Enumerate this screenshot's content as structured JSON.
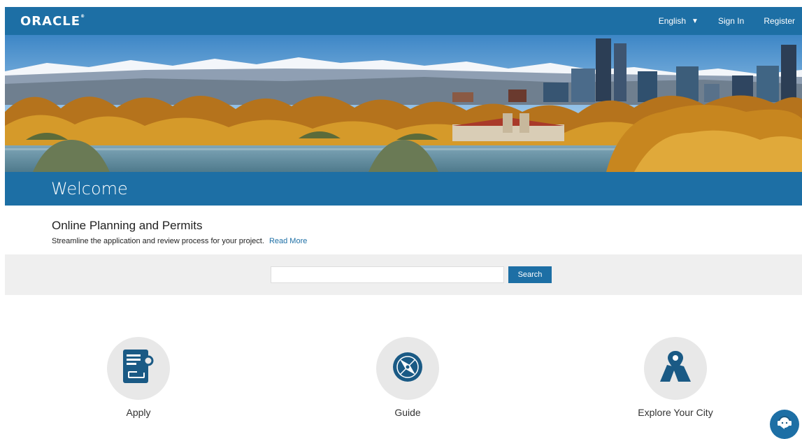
{
  "header": {
    "logo_text": "ORACLE",
    "logo_mark": "®",
    "language": "English",
    "sign_in": "Sign In",
    "register": "Register"
  },
  "hero": {
    "image": "denver-skyline-lake-autumn-banner"
  },
  "welcome": {
    "title": "Welcome"
  },
  "intro": {
    "title": "Online Planning and Permits",
    "description": "Streamline the application and review process for your project.",
    "read_more": "Read More"
  },
  "search": {
    "value": "",
    "placeholder": "",
    "button_label": "Search"
  },
  "tiles": [
    {
      "label": "Apply",
      "icon": "application-form-icon"
    },
    {
      "label": "Guide",
      "icon": "compass-icon"
    },
    {
      "label": "Explore Your City",
      "icon": "map-pin-icon"
    }
  ],
  "chat": {
    "icon": "chat-assistant-icon"
  },
  "colors": {
    "brand_blue": "#1d6fa5",
    "icon_blue": "#1a5a85",
    "band_gray": "#efefef",
    "tile_circle": "#e8e8e8"
  }
}
